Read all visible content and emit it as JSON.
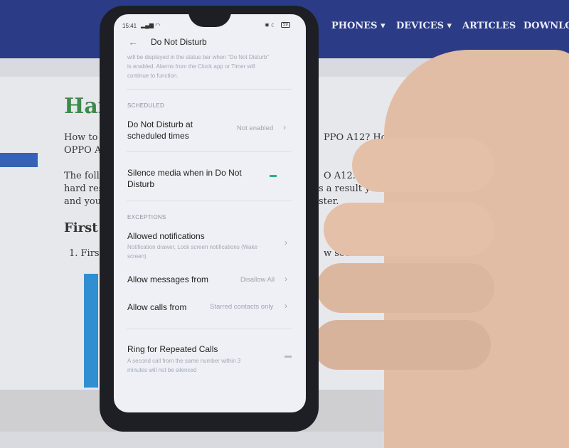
{
  "website": {
    "nav": [
      "PHONES ▾",
      "DEVICES ▾",
      "ARTICLES",
      "DOWNLOA"
    ],
    "heading": "Har",
    "lines": [
      "How to f",
      "PPO A12? How to bypass screen l",
      "OPPO A1",
      "The follo",
      "O A12. C",
      "hard rese",
      "s a result your OPPO A12 will",
      "and you",
      "ster.",
      "First",
      "1. Firs",
      "w seconds"
    ]
  },
  "phone": {
    "status": {
      "time": "15:41",
      "battery": "59"
    },
    "title": "Do Not Disturb",
    "intro": "will be displayed in the status bar when \"Do Not Disturb\" is enabled. Alarms from the Clock app or Timer will continue to function.",
    "scheduled_header": "SCHEDULED",
    "scheduled_row": {
      "label": "Do Not Disturb at scheduled times",
      "value": "Not enabled"
    },
    "silence_media": {
      "label": "Silence media when in Do Not Disturb",
      "enabled": true
    },
    "exceptions_header": "EXCEPTIONS",
    "allowed_notifications": {
      "label": "Allowed notifications",
      "sub": "Notification drawer, Lock screen notifications (Wake screen)"
    },
    "allow_messages": {
      "label": "Allow messages from",
      "value": "Disallow All"
    },
    "allow_calls": {
      "label": "Allow calls from",
      "value": "Starred contacts only"
    },
    "repeated_calls": {
      "label": "Ring for Repeated Calls",
      "sub": "A second call from the same number within 3 minutes will not be silenced",
      "enabled": false
    },
    "accent": "#2bb18a"
  }
}
